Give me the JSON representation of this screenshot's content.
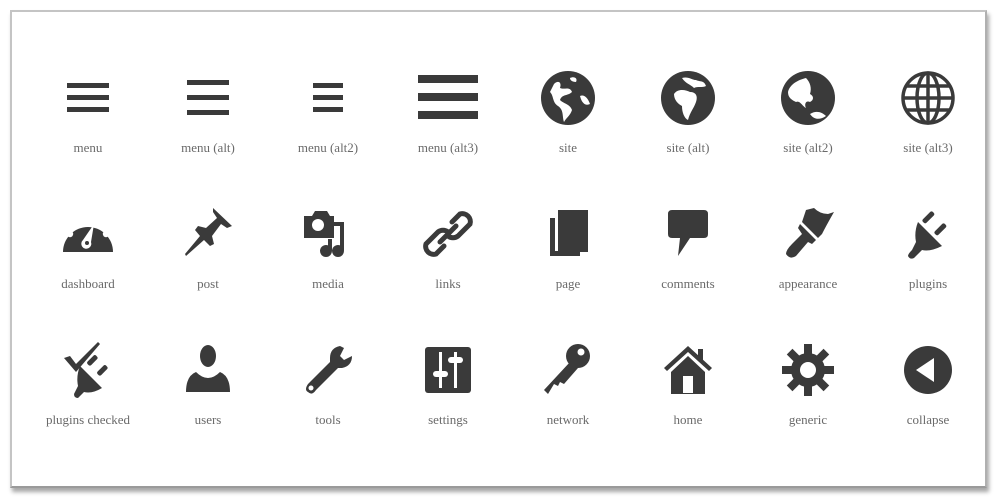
{
  "icon_color": "#3a3a3a",
  "label_color": "#6a6a6a",
  "rows": [
    [
      {
        "id": "menu",
        "label": "menu",
        "icon": "menu-icon"
      },
      {
        "id": "menu-alt",
        "label": "menu (alt)",
        "icon": "menu-alt-icon"
      },
      {
        "id": "menu-alt2",
        "label": "menu (alt2)",
        "icon": "menu-alt2-icon"
      },
      {
        "id": "menu-alt3",
        "label": "menu (alt3)",
        "icon": "menu-alt3-icon"
      },
      {
        "id": "site",
        "label": "site",
        "icon": "globe-americas-icon"
      },
      {
        "id": "site-alt",
        "label": "site (alt)",
        "icon": "globe-africa-icon"
      },
      {
        "id": "site-alt2",
        "label": "site (alt2)",
        "icon": "globe-asia-icon"
      },
      {
        "id": "site-alt3",
        "label": "site (alt3)",
        "icon": "globe-grid-icon"
      }
    ],
    [
      {
        "id": "dashboard",
        "label": "dashboard",
        "icon": "dashboard-gauge-icon"
      },
      {
        "id": "post",
        "label": "post",
        "icon": "pushpin-icon"
      },
      {
        "id": "media",
        "label": "media",
        "icon": "camera-music-icon"
      },
      {
        "id": "links",
        "label": "links",
        "icon": "chain-link-icon"
      },
      {
        "id": "page",
        "label": "page",
        "icon": "pages-icon"
      },
      {
        "id": "comments",
        "label": "comments",
        "icon": "speech-bubble-icon"
      },
      {
        "id": "appearance",
        "label": "appearance",
        "icon": "paintbrush-icon"
      },
      {
        "id": "plugins",
        "label": "plugins",
        "icon": "plug-icon"
      }
    ],
    [
      {
        "id": "plugins-checked",
        "label": "plugins checked",
        "icon": "plug-checked-icon"
      },
      {
        "id": "users",
        "label": "users",
        "icon": "user-icon"
      },
      {
        "id": "tools",
        "label": "tools",
        "icon": "wrench-icon"
      },
      {
        "id": "settings",
        "label": "settings",
        "icon": "sliders-icon"
      },
      {
        "id": "network",
        "label": "network",
        "icon": "key-icon"
      },
      {
        "id": "home",
        "label": "home",
        "icon": "house-icon"
      },
      {
        "id": "generic",
        "label": "generic",
        "icon": "gear-icon"
      },
      {
        "id": "collapse",
        "label": "collapse",
        "icon": "collapse-arrow-icon"
      }
    ]
  ]
}
